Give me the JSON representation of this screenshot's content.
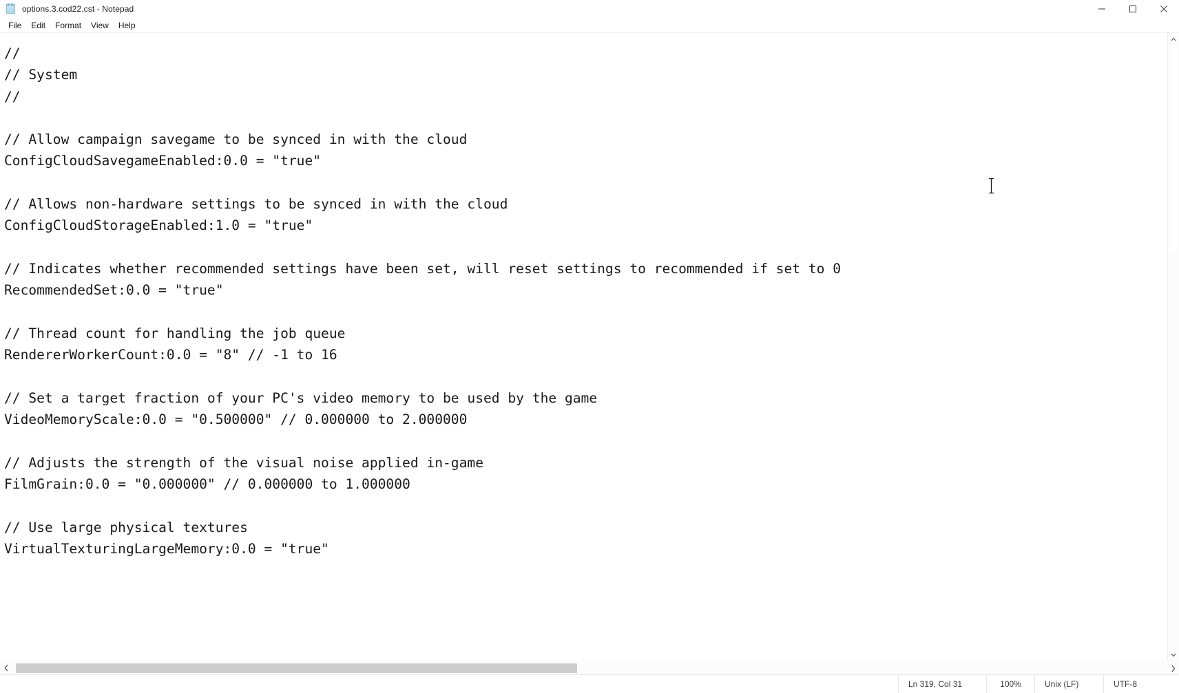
{
  "window": {
    "title": "options.3.cod22.cst - Notepad",
    "app_icon": "notepad-icon",
    "controls": {
      "minimize": "minimize-icon",
      "maximize": "maximize-icon",
      "close": "close-icon"
    }
  },
  "menu": {
    "items": [
      {
        "label": "File"
      },
      {
        "label": "Edit"
      },
      {
        "label": "Format"
      },
      {
        "label": "View"
      },
      {
        "label": "Help"
      }
    ]
  },
  "editor": {
    "content": "//\n// System\n//\n\n// Allow campaign savegame to be synced in with the cloud\nConfigCloudSavegameEnabled:0.0 = \"true\"\n\n// Allows non-hardware settings to be synced in with the cloud\nConfigCloudStorageEnabled:1.0 = \"true\"\n\n// Indicates whether recommended settings have been set, will reset settings to recommended if set to 0\nRecommendedSet:0.0 = \"true\"\n\n// Thread count for handling the job queue\nRendererWorkerCount:0.0 = \"8\" // -1 to 16\n\n// Set a target fraction of your PC's video memory to be used by the game\nVideoMemoryScale:0.0 = \"0.500000\" // 0.000000 to 2.000000\n\n// Adjusts the strength of the visual noise applied in-game\nFilmGrain:0.0 = \"0.000000\" // 0.000000 to 1.000000\n\n// Use large physical textures\nVirtualTexturingLargeMemory:0.0 = \"true\"\n",
    "lines": [
      "//",
      "// System",
      "//",
      "",
      "// Allow campaign savegame to be synced in with the cloud",
      "ConfigCloudSavegameEnabled:0.0 = \"true\"",
      "",
      "// Allows non-hardware settings to be synced in with the cloud",
      "ConfigCloudStorageEnabled:1.0 = \"true\"",
      "",
      "// Indicates whether recommended settings have been set, will reset settings to recommended if set to 0",
      "RecommendedSet:0.0 = \"true\"",
      "",
      "// Thread count for handling the job queue",
      "RendererWorkerCount:0.0 = \"8\" // -1 to 16",
      "",
      "// Set a target fraction of your PC's video memory to be used by the game",
      "VideoMemoryScale:0.0 = \"0.500000\" // 0.000000 to 2.000000",
      "",
      "// Adjusts the strength of the visual noise applied in-game",
      "FilmGrain:0.0 = \"0.000000\" // 0.000000 to 1.000000",
      "",
      "// Use large physical textures",
      "VirtualTexturingLargeMemory:0.0 = \"true\"",
      ""
    ]
  },
  "scrollbars": {
    "horizontal": {
      "left_arrow": "chevron-left-icon",
      "right_arrow": "chevron-right-icon"
    },
    "vertical": {
      "up_arrow": "chevron-up-icon",
      "down_arrow": "chevron-down-icon"
    }
  },
  "statusbar": {
    "position": "Ln 319, Col 31",
    "zoom": "100%",
    "line_ending": "Unix (LF)",
    "encoding": "UTF-8"
  },
  "colors": {
    "background": "#ffffff",
    "text": "#1a1a1a",
    "scrollbar_thumb": "#cdcdcd",
    "border": "#e6e6e6"
  }
}
